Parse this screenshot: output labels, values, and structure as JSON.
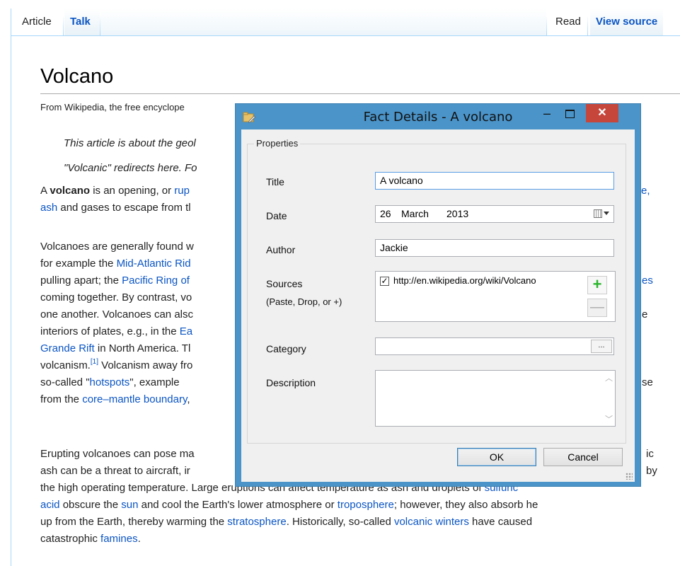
{
  "tabs": {
    "article": "Article",
    "talk": "Talk",
    "read": "Read",
    "view_source": "View source"
  },
  "page": {
    "title": "Volcano",
    "subtitle": "From Wikipedia, the free encyclope",
    "hatnote1": "This article is about the geol",
    "hatnote2": "\"Volcanic\" redirects here. Fo",
    "p1": {
      "l1a": "A ",
      "l1b": "volcano",
      "l1c": " is an opening, or ",
      "l1d": "rup",
      "l1e": "e,",
      "l2a": "ash",
      "l2b": " and gases to escape from tl"
    },
    "p2": {
      "l1": "Volcanoes are generally found w",
      "l2a": "for example the ",
      "l2b": "Mid-Atlantic Rid",
      "l3a": "pulling apart; the ",
      "l3b": "Pacific Ring of",
      "l3c": "es",
      "l4": "coming together. By contrast, vo",
      "l5": "one another. Volcanoes can alsc",
      "l5b": "e",
      "l6a": "interiors of plates, e.g., in the ",
      "l6b": "Ea",
      "l7a": "Grande Rift",
      "l7b": " in North America. Tl",
      "l8a": "volcanism.",
      "l8b": "[1]",
      "l8c": " Volcanism away fro",
      "l8d": "se",
      "l9a": "so-called \"",
      "l9b": "hotspots",
      "l9c": "\", example",
      "l10a": "from the ",
      "l10b": "core–mantle boundary",
      "l10c": ","
    },
    "p3": {
      "l1": "Erupting volcanoes can pose ma",
      "l1b": "ic",
      "l2": "ash can be a threat to aircraft, ir",
      "l2b": "by",
      "l3a": "the high operating temperature. Large eruptions can affect temperature as ash and droplets of ",
      "l3b": "sulfuric",
      "l4a": "acid",
      "l4b": " obscure the ",
      "l4c": "sun",
      "l4d": " and cool the Earth's lower atmosphere or ",
      "l4e": "troposphere",
      "l4f": "; however, they also absorb he",
      "l5a": "up from the Earth, thereby warming the ",
      "l5b": "stratosphere",
      "l5c": ". Historically, so-called ",
      "l5d": "volcanic winters",
      "l5e": " have caused",
      "l6a": "catastrophic ",
      "l6b": "famines",
      "l6c": "."
    }
  },
  "dialog": {
    "title": "Fact Details - A volcano",
    "group_label": "Properties",
    "labels": {
      "title": "Title",
      "date": "Date",
      "author": "Author",
      "sources": "Sources",
      "sources_hint": "(Paste, Drop, or +)",
      "category": "Category",
      "description": "Description"
    },
    "values": {
      "title": "A volcano",
      "date_day": "26",
      "date_month": "March",
      "date_year": "2013",
      "author": "Jackie",
      "source_url": "http://en.wikipedia.org/wiki/Volcano",
      "source_checked": true,
      "category": "",
      "description": ""
    },
    "buttons": {
      "ok": "OK",
      "cancel": "Cancel",
      "browse": "...",
      "add": "+",
      "remove": "—"
    }
  },
  "colors": {
    "dialog_frame": "#4a94c9",
    "close_button": "#c7463c",
    "link": "#0b55c4"
  }
}
